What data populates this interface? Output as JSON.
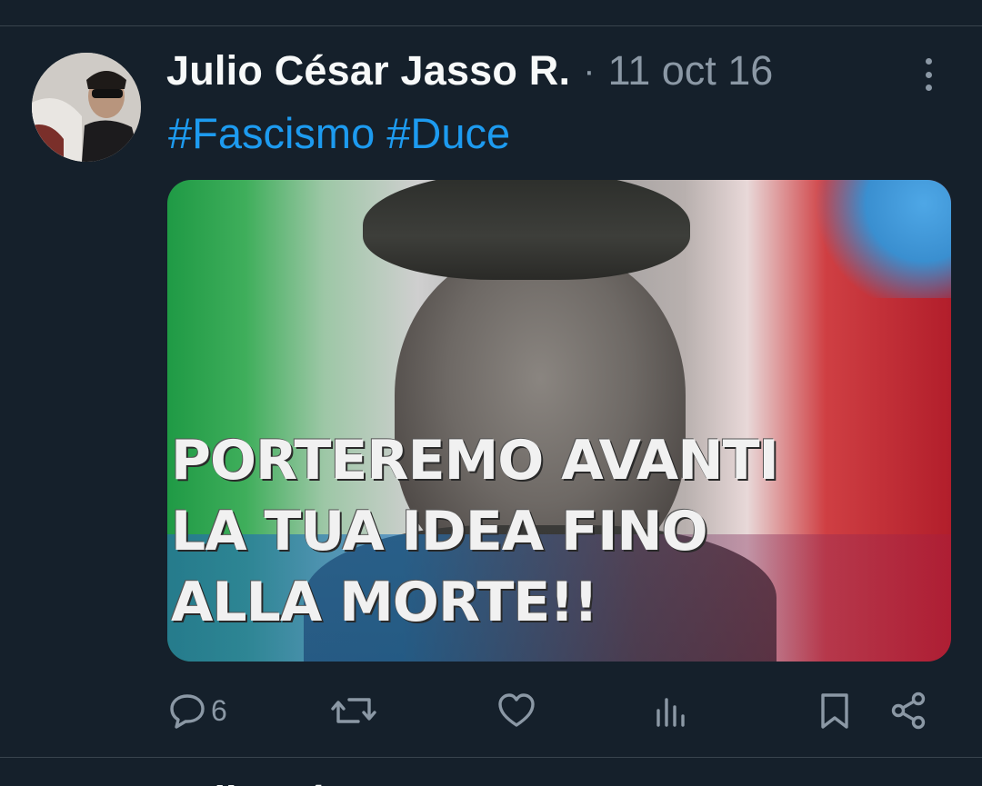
{
  "tweet": {
    "author_name": "Julio César Jasso R.",
    "separator": "·",
    "timestamp": "11 oct 16",
    "hashtags": [
      "#Fascismo",
      "#Duce"
    ],
    "media_caption_lines": [
      "PORTEREMO AVANTI",
      "LA TUA IDEA FINO",
      "ALLA MORTE!!"
    ],
    "reply_count": "6"
  },
  "next_tweet": {
    "author_name": "Julio César Jasso R."
  },
  "colors": {
    "background": "#15202b",
    "text": "#f7f9f9",
    "secondary_text": "#8b98a5",
    "link": "#1d9bf0",
    "divider": "#38444d"
  },
  "icons": {
    "reply": "speech-bubble-icon",
    "retweet": "retweet-arrows-icon",
    "like": "heart-icon",
    "views": "bar-chart-icon",
    "bookmark": "bookmark-icon",
    "share": "share-nodes-icon",
    "more": "vertical-ellipsis-icon"
  }
}
